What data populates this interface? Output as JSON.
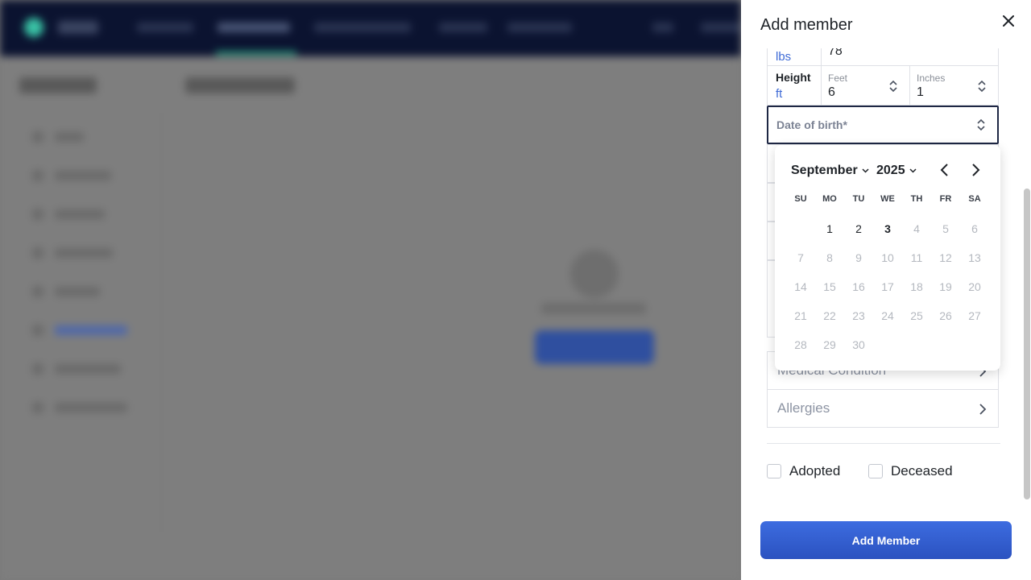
{
  "drawer": {
    "title": "Add member",
    "weight": {
      "unit": "lbs",
      "value": "78"
    },
    "height": {
      "label": "Height",
      "unit": "ft",
      "feet_caption": "Feet",
      "feet_value": "6",
      "inches_caption": "Inches",
      "inches_value": "1"
    },
    "dob": {
      "label": "Date of birth*"
    },
    "medical_label": "Medical Condition",
    "allergies_label": "Allergies",
    "adopted_label": "Adopted",
    "deceased_label": "Deceased",
    "add_button": "Add Member"
  },
  "calendar": {
    "month": "September",
    "year": "2025",
    "weekdays": [
      "SU",
      "MO",
      "TU",
      "WE",
      "TH",
      "FR",
      "SA"
    ],
    "first_weekday_index": 1,
    "days_in_month": 30,
    "today": 3,
    "available_days": [
      1,
      2,
      3
    ]
  },
  "colors": {
    "accent": "#2b52c0",
    "unit_text": "#3f6bd6",
    "focus_border": "#1e2744"
  }
}
